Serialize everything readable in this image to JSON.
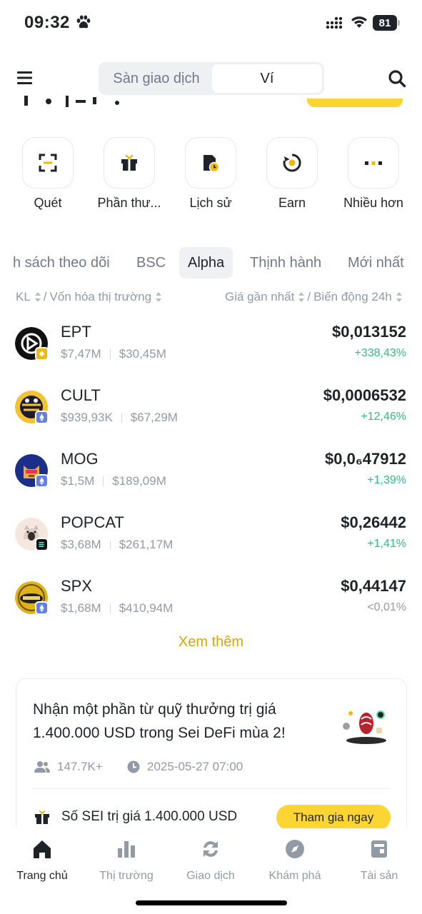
{
  "status_bar": {
    "time": "09:32",
    "battery": "81"
  },
  "header": {
    "segments": [
      "Sàn giao dịch",
      "Ví"
    ],
    "active_segment": "Ví"
  },
  "quick_actions": [
    {
      "label": "Quét",
      "icon": "scan-icon"
    },
    {
      "label": "Phần thư...",
      "icon": "gift-icon"
    },
    {
      "label": "Lịch sử",
      "icon": "history-icon"
    },
    {
      "label": "Earn",
      "icon": "earn-icon"
    },
    {
      "label": "Nhiều hơn",
      "icon": "more-icon"
    }
  ],
  "tabs": [
    "h sách theo dõi",
    "BSC",
    "Alpha",
    "Thịnh hành",
    "Mới nhất"
  ],
  "active_tab": "Alpha",
  "columns": {
    "left_a": "KL",
    "sep": "/",
    "left_b": "Vốn hóa thị trường",
    "right_a": "Giá gần nhất",
    "right_b": "Biến động 24h"
  },
  "tokens": [
    {
      "symbol": "EPT",
      "volume": "$7,47M",
      "mcap": "$30,45M",
      "price": "$0,013152",
      "change": "+338,43%",
      "chain": "bsc",
      "logo_color": "#111111"
    },
    {
      "symbol": "CULT",
      "volume": "$939,93K",
      "mcap": "$67,29M",
      "price": "$0,0006532",
      "change": "+12,46%",
      "chain": "eth",
      "logo_color": "#f2c230"
    },
    {
      "symbol": "MOG",
      "volume": "$1,5M",
      "mcap": "$189,09M",
      "price": "$0,0₆47912",
      "change": "+1,39%",
      "chain": "eth",
      "logo_color": "#1b2f8a"
    },
    {
      "symbol": "POPCAT",
      "volume": "$3,68M",
      "mcap": "$261,17M",
      "price": "$0,26442",
      "change": "+1,41%",
      "chain": "sol",
      "logo_color": "#f6e6e0"
    },
    {
      "symbol": "SPX",
      "volume": "$1,68M",
      "mcap": "$410,94M",
      "price": "$0,44147",
      "change": "<0,01%",
      "chain": "eth",
      "logo_color": "#e0b21a"
    }
  ],
  "see_more": "Xem thêm",
  "promo": {
    "title": "Nhận một phần từ quỹ thưởng trị giá 1.400.000 USD trong Sei DeFi mùa 2!",
    "participants": "147.7K+",
    "datetime": "2025-05-27 07:00",
    "reward": "Số SEI trị giá 1.400.000 USD",
    "cta": "Tham gia ngay"
  },
  "bottom_nav": [
    {
      "label": "Trang chủ",
      "icon": "home-icon",
      "active": true
    },
    {
      "label": "Thị trường",
      "icon": "markets-icon",
      "active": false
    },
    {
      "label": "Giao dịch",
      "icon": "trade-icon",
      "active": false
    },
    {
      "label": "Khám phá",
      "icon": "discover-icon",
      "active": false
    },
    {
      "label": "Tài sản",
      "icon": "assets-icon",
      "active": false
    }
  ],
  "colors": {
    "accent": "#fcd535",
    "positive": "#2ebd85",
    "muted": "#929aa5",
    "link": "#d8a408"
  }
}
